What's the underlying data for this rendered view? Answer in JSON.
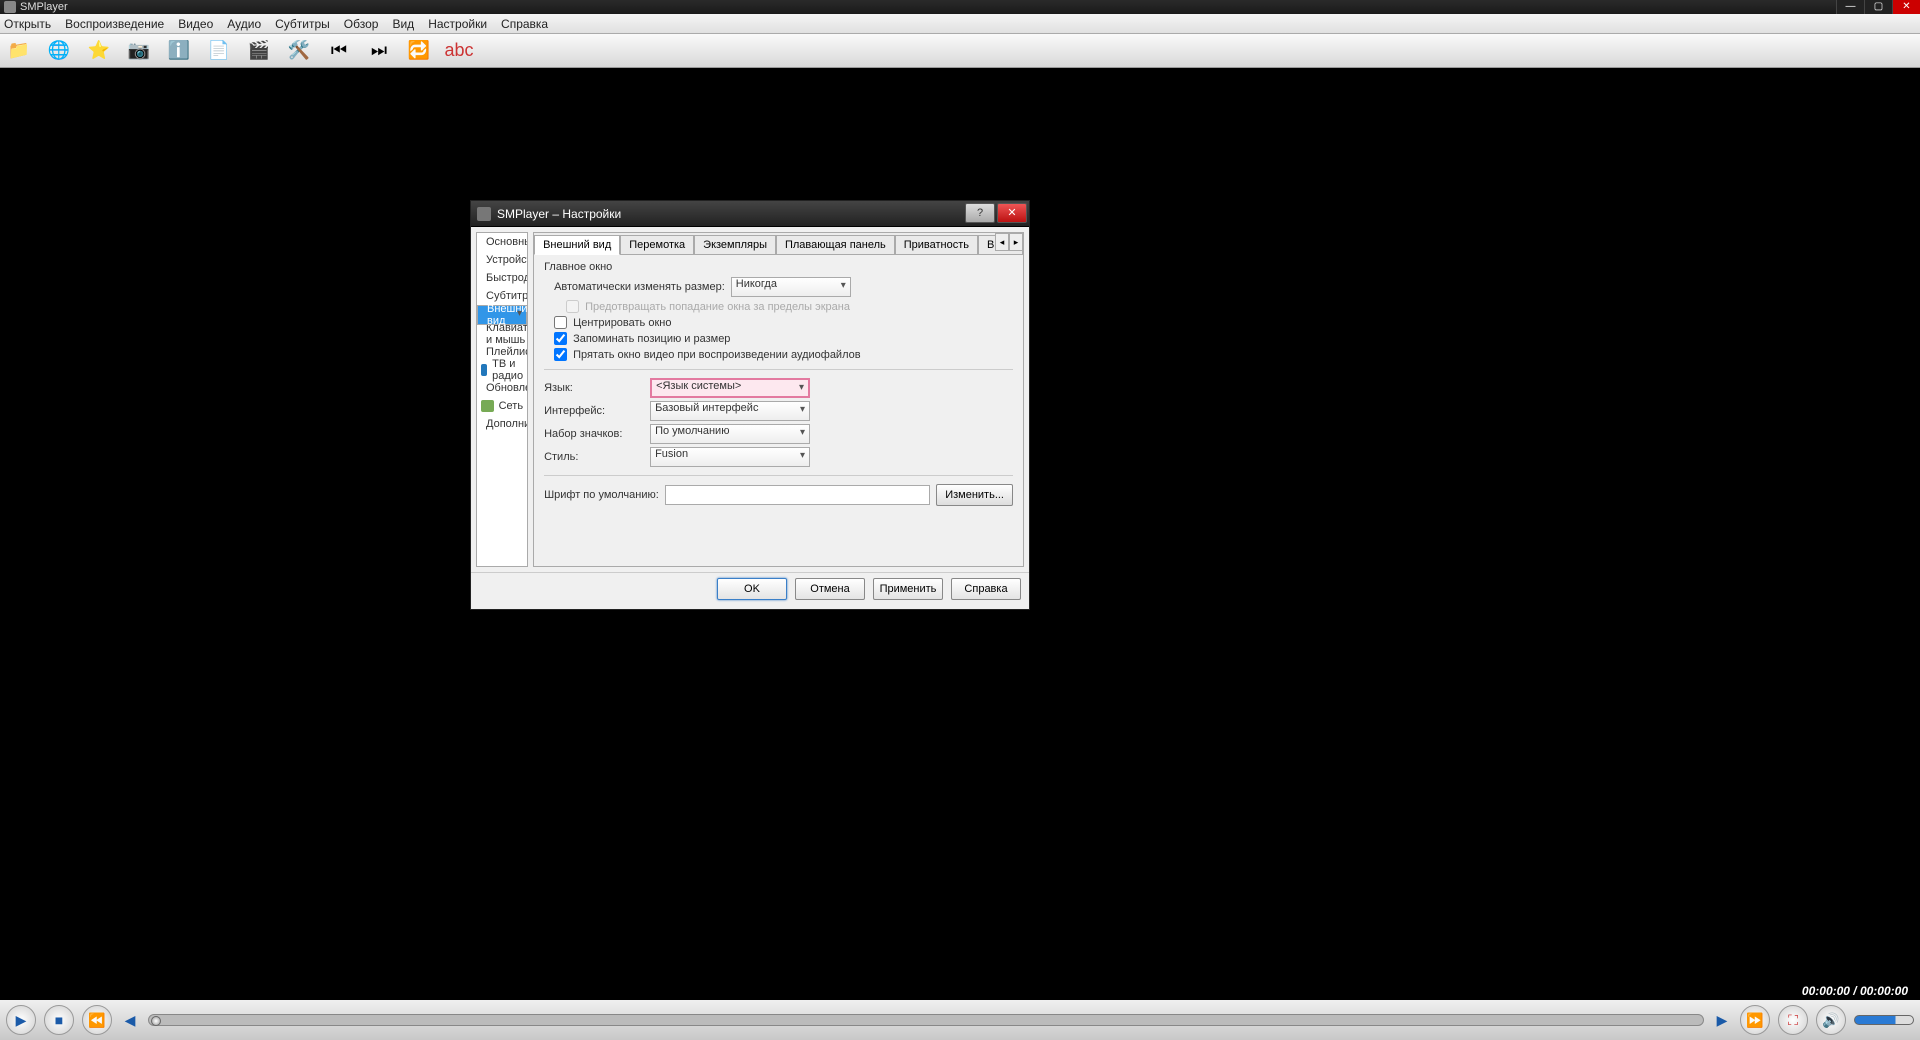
{
  "main_window": {
    "title": "SMPlayer",
    "win_min": "—",
    "win_max": "▢",
    "win_close": "✕"
  },
  "menu": {
    "open": "Открыть",
    "playback": "Воспроизведение",
    "video": "Видео",
    "audio": "Аудио",
    "subtitles": "Субтитры",
    "browse": "Обзор",
    "view": "Вид",
    "settings": "Настройки",
    "help": "Справка"
  },
  "time": "00:00:00 / 00:00:00",
  "dialog": {
    "title": "SMPlayer – Настройки",
    "categories": [
      "Основные",
      "Устройства",
      "Быстродействие",
      "Субтитры",
      "Внешний вид",
      "Клавиатура и мышь",
      "Плейлист",
      "ТВ и радио",
      "Обновления",
      "Сеть",
      "Дополнительно"
    ],
    "tabs": [
      "Внешний вид",
      "Перемотка",
      "Экземпляры",
      "Плавающая панель",
      "Приватность",
      "Высо"
    ],
    "grp_main": "Главное окно",
    "lbl_autoresize": "Автоматически изменять размер:",
    "val_autoresize": "Никогда",
    "chk_prevent": "Предотвращать попадание окна за пределы экрана",
    "chk_center": "Центрировать окно",
    "chk_remember": "Запоминать позицию и размер",
    "chk_hide": "Прятать окно видео при воспроизведении аудиофайлов",
    "lbl_language": "Язык:",
    "val_language": "<Язык системы>",
    "lbl_interface": "Интерфейс:",
    "val_interface": "Базовый интерфейс",
    "lbl_iconset": "Набор значков:",
    "val_iconset": "По умолчанию",
    "lbl_style": "Стиль:",
    "val_style": "Fusion",
    "lbl_font": "Шрифт по умолчанию:",
    "btn_change": "Изменить...",
    "btn_ok": "OK",
    "btn_cancel": "Отмена",
    "btn_apply": "Применить",
    "btn_help": "Справка"
  }
}
